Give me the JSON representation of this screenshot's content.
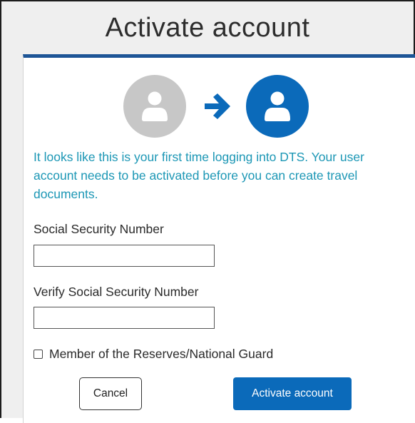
{
  "header": {
    "title": "Activate account"
  },
  "illustration": {
    "from_icon": "user-icon",
    "arrow_icon": "arrow-right-icon",
    "to_icon": "user-icon",
    "colors": {
      "inactive": "#c7c7c7",
      "active": "#0b6aba",
      "arrow": "#0b6aba"
    }
  },
  "intro_text": "It looks like this is your first time logging into DTS. Your user account needs to be activated before you can create travel documents.",
  "form": {
    "ssn_label": "Social Security Number",
    "ssn_value": "",
    "verify_ssn_label": "Verify Social Security Number",
    "verify_ssn_value": "",
    "reserves_checkbox_label": "Member of the Reserves/National Guard",
    "reserves_checked": false
  },
  "buttons": {
    "cancel_label": "Cancel",
    "activate_label": "Activate account"
  },
  "colors": {
    "accent_bar": "#1d5596",
    "intro_text": "#1c97b5",
    "primary_button": "#0b6aba"
  }
}
